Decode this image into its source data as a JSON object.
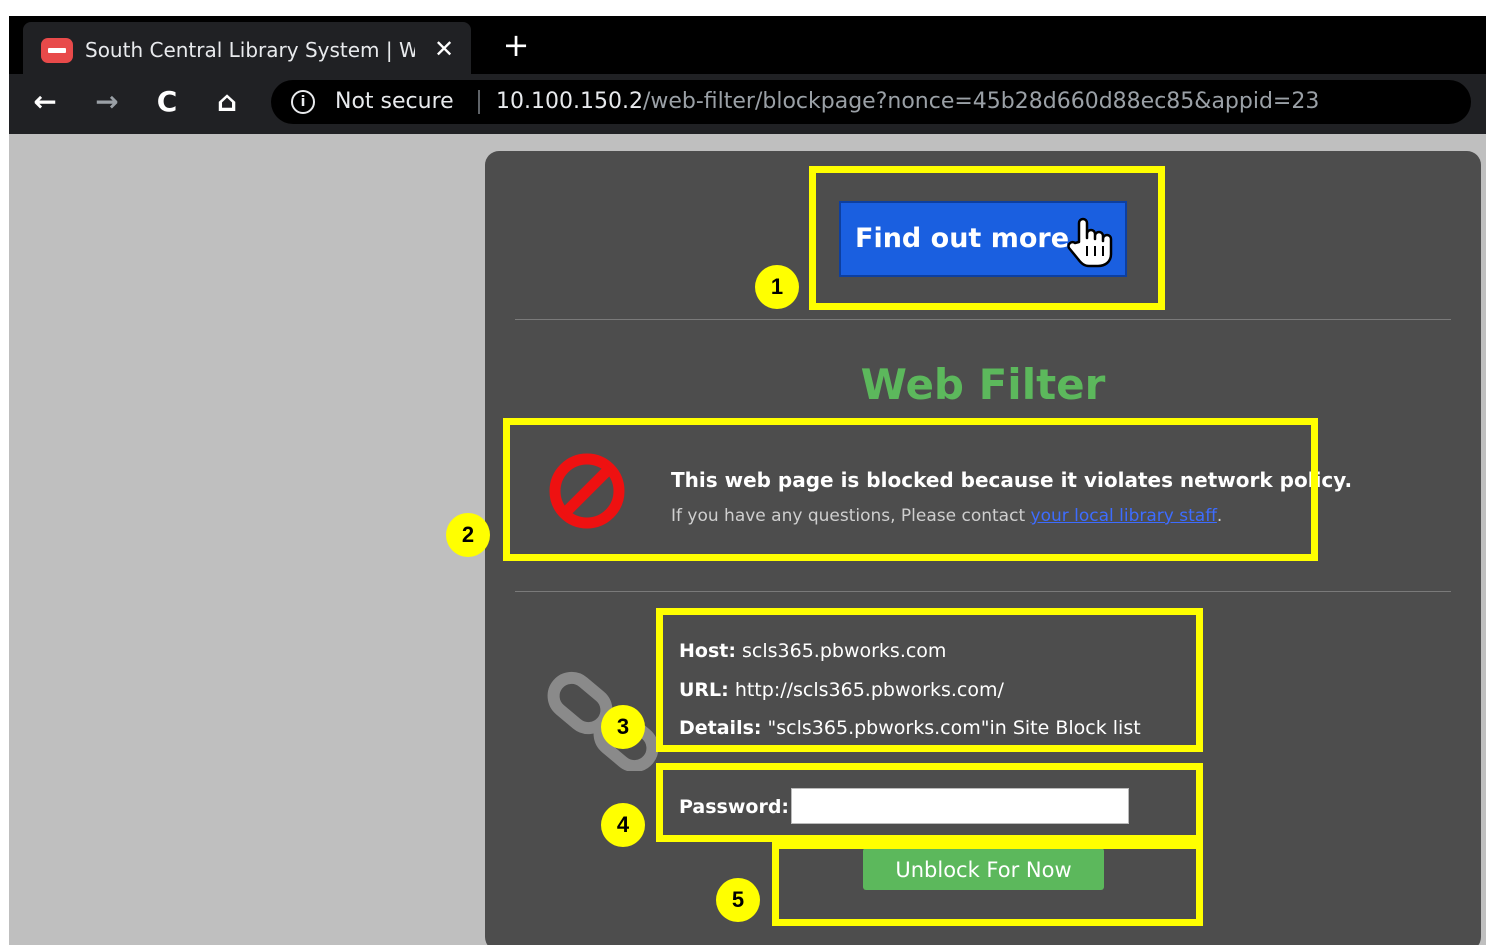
{
  "tab": {
    "title": "South Central Library System | Web Filter",
    "close_glyph": "✕",
    "new_tab_glyph": "+"
  },
  "toolbar": {
    "back_glyph": "←",
    "forward_glyph": "→",
    "reload_glyph": "C",
    "home_glyph": "⌂",
    "info_glyph": "i",
    "security_label": "Not secure",
    "url_host": "10.100.150.2",
    "url_path": "/web-filter/blockpage?nonce=45b28d660d88ec85&appid=23"
  },
  "page": {
    "find_more_label": "Find out more",
    "title": "Web Filter",
    "blocked_message": "This web page is blocked because it violates network policy.",
    "contact_prefix": "If you have any questions, Please contact ",
    "contact_link": "your local library staff",
    "contact_suffix": ".",
    "host_label": "Host:",
    "host_value": "scls365.pbworks.com",
    "url_label": "URL:",
    "url_value": "http://scls365.pbworks.com/",
    "details_label": "Details:",
    "details_value": "\"scls365.pbworks.com\"in Site Block list",
    "password_label": "Password:",
    "password_value": "",
    "unblock_label": "Unblock For Now"
  },
  "annotations": {
    "badges": [
      "1",
      "2",
      "3",
      "4",
      "5"
    ],
    "highlight_color": "#ffff00"
  },
  "colors": {
    "title_green": "#5cb85c",
    "button_blue": "#1a5fe0",
    "panel_bg": "#4d4d4d",
    "page_bg": "#bfbfbf"
  },
  "icons": [
    "stop-favicon-icon",
    "close-icon",
    "plus-icon",
    "back-arrow-icon",
    "forward-arrow-icon",
    "reload-icon",
    "home-icon",
    "info-icon",
    "hand-pointer-icon",
    "block-icon",
    "chain-link-icon"
  ]
}
